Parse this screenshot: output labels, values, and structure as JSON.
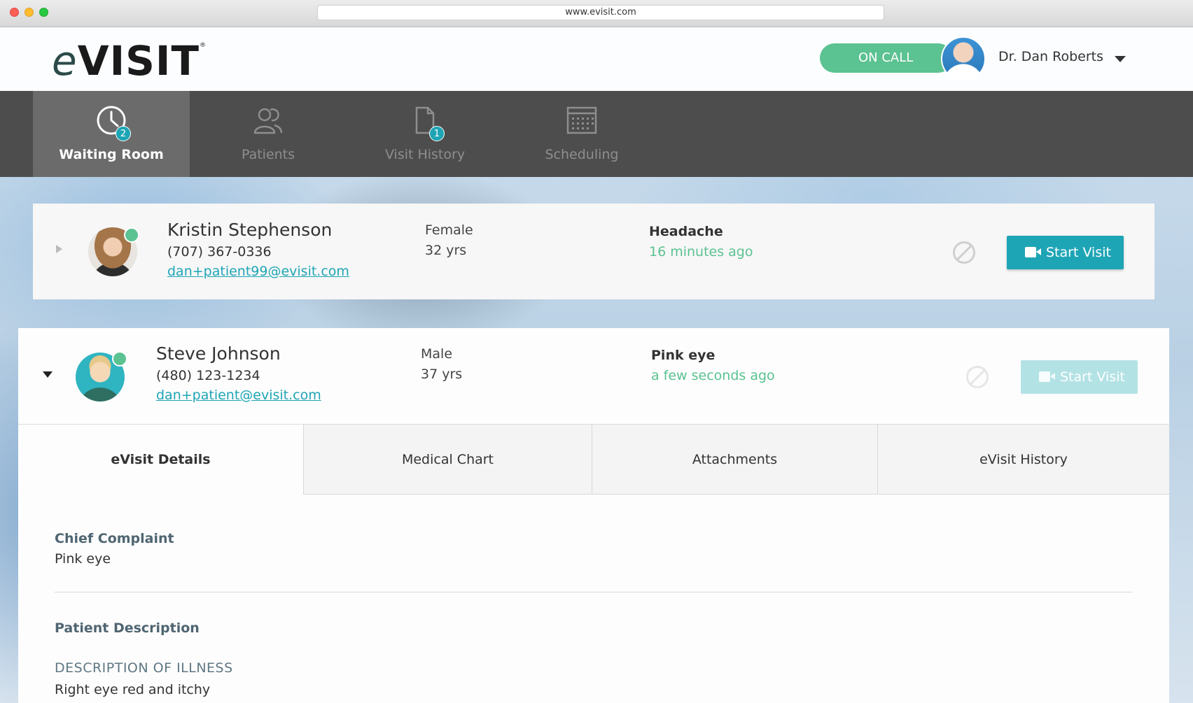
{
  "browser": {
    "url": "www.evisit.com"
  },
  "header": {
    "logo_text": "eVisit",
    "on_call_label": "ON CALL",
    "doctor_name": "Dr. Dan Roberts"
  },
  "nav": {
    "items": [
      {
        "label": "Waiting Room",
        "badge": "2",
        "icon": "clock-icon",
        "active": true
      },
      {
        "label": "Patients",
        "badge": "",
        "icon": "patients-icon",
        "active": false
      },
      {
        "label": "Visit History",
        "badge": "1",
        "icon": "document-icon",
        "active": false
      },
      {
        "label": "Scheduling",
        "badge": "",
        "icon": "calendar-icon",
        "active": false
      }
    ]
  },
  "patients": [
    {
      "name": "Kristin Stephenson",
      "phone": "(707) 367-0336",
      "email": "dan+patient99@evisit.com",
      "gender": "Female",
      "age": "32 yrs",
      "complaint": "Headache",
      "waiting": "16 minutes ago",
      "start_label": "Start Visit",
      "expanded": false
    },
    {
      "name": "Steve Johnson",
      "phone": "(480) 123-1234",
      "email": "dan+patient@evisit.com",
      "gender": "Male",
      "age": "37 yrs",
      "complaint": "Pink eye",
      "waiting": "a few seconds ago",
      "start_label": "Start Visit",
      "expanded": true
    }
  ],
  "detail_tabs": [
    "eVisit Details",
    "Medical Chart",
    "Attachments",
    "eVisit History"
  ],
  "details": {
    "chief_complaint_title": "Chief Complaint",
    "chief_complaint": "Pink eye",
    "patient_description_title": "Patient Description",
    "illness_title": "DESCRIPTION OF ILLNESS",
    "illness": "Right eye red and itchy"
  },
  "colors": {
    "accent": "#1ea5b5",
    "on_call": "#5bc291",
    "nav_bg": "#4d4d4d",
    "nav_active": "#6b6b6b"
  }
}
